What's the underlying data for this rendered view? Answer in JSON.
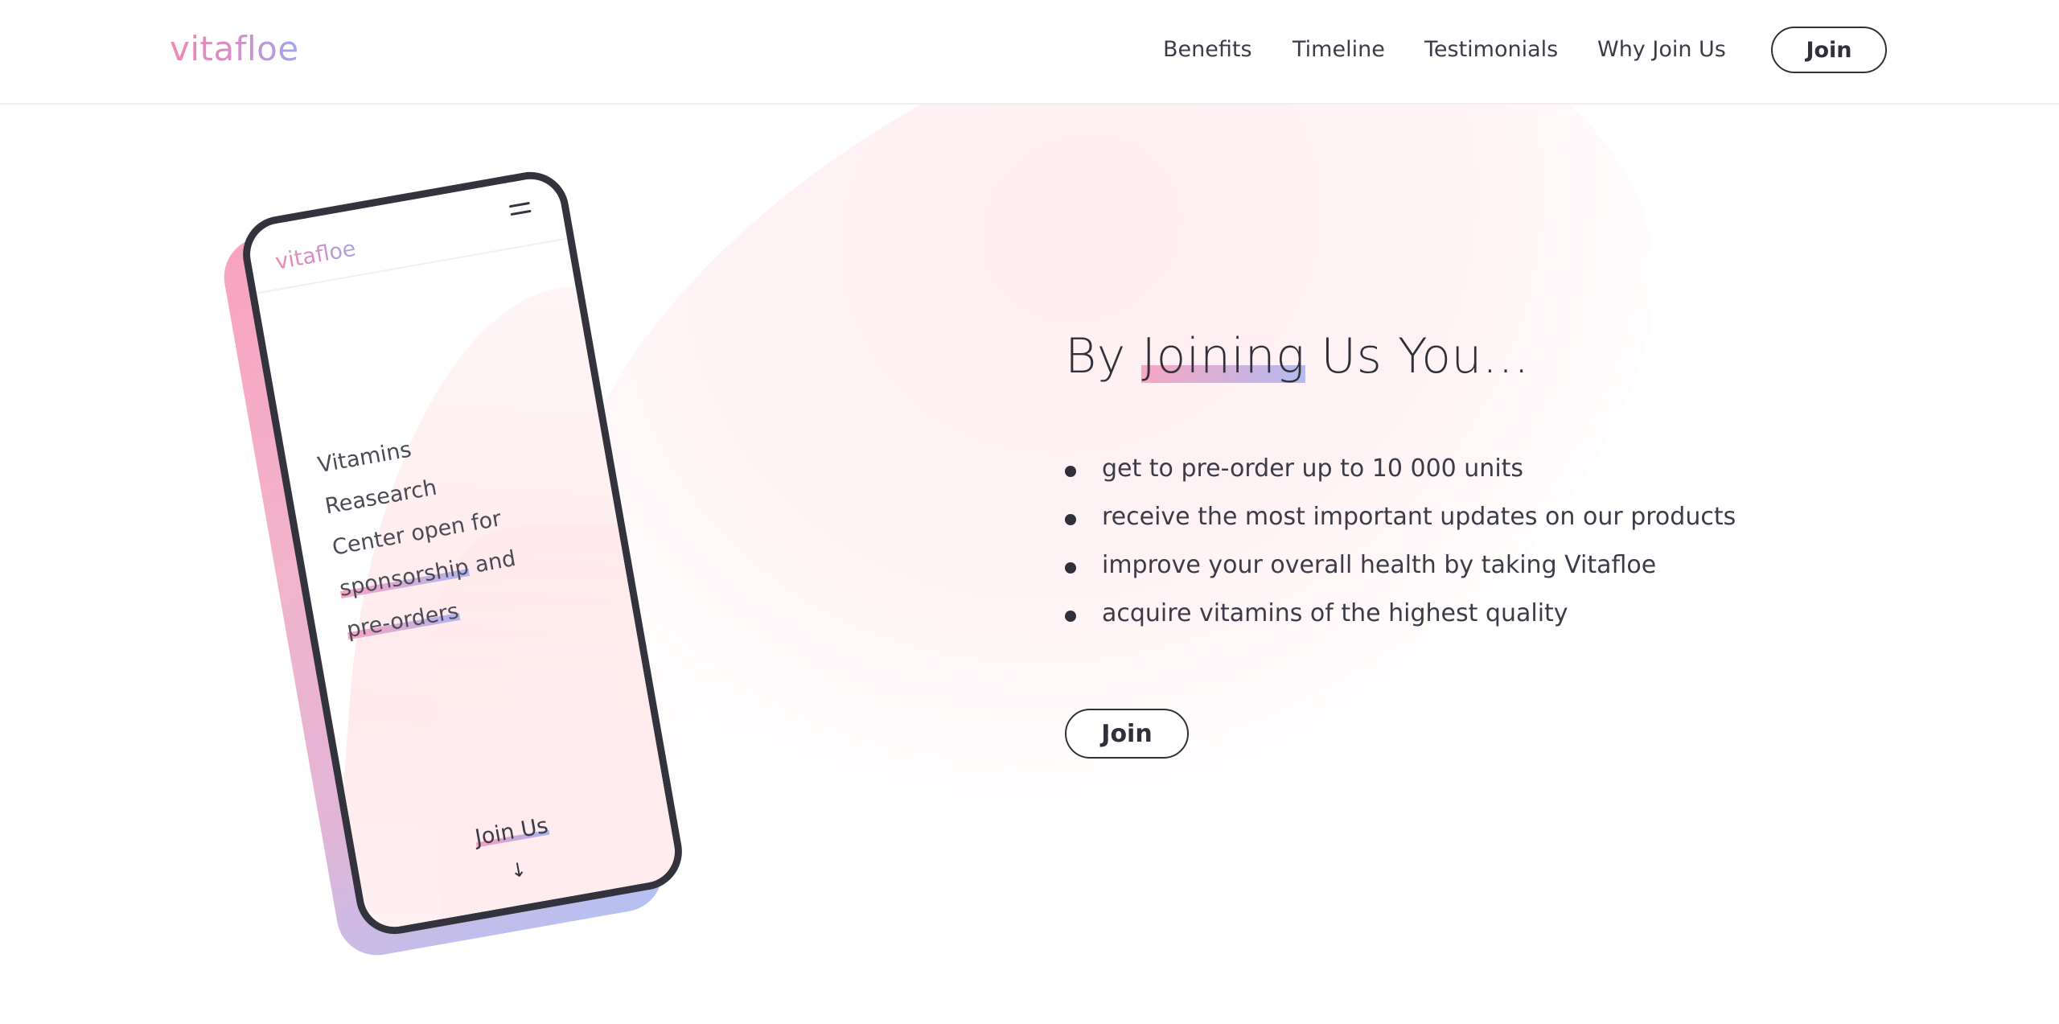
{
  "header": {
    "logo": "vitafloe",
    "nav": [
      {
        "label": "Benefits"
      },
      {
        "label": "Timeline"
      },
      {
        "label": "Testimonials"
      },
      {
        "label": "Why Join Us"
      }
    ],
    "join_label": "Join"
  },
  "phone": {
    "logo": "vitafloe",
    "headline_line1": "Vitamins Reasearch",
    "headline_line2": "Center open for",
    "headline_hl1": "sponsorship",
    "headline_and": "and",
    "headline_hl2": "pre-orders",
    "join_label": "Join Us",
    "arrow": "↓",
    "icons": [
      "menu-icon",
      "arrow-down-icon"
    ]
  },
  "main": {
    "heading_pre": "By",
    "heading_highlight": "Joining",
    "heading_post": "Us You...",
    "benefits": [
      "get to pre-order up to 10 000 units",
      "receive the most important updates on our products",
      "improve your overall health by taking Vitafloe",
      "acquire vitamins of the highest quality"
    ],
    "join_label": "Join"
  },
  "colors": {
    "accent_pink": "#ef86b0",
    "accent_blue": "#9fa6ea",
    "text_dark": "#2f303a"
  }
}
